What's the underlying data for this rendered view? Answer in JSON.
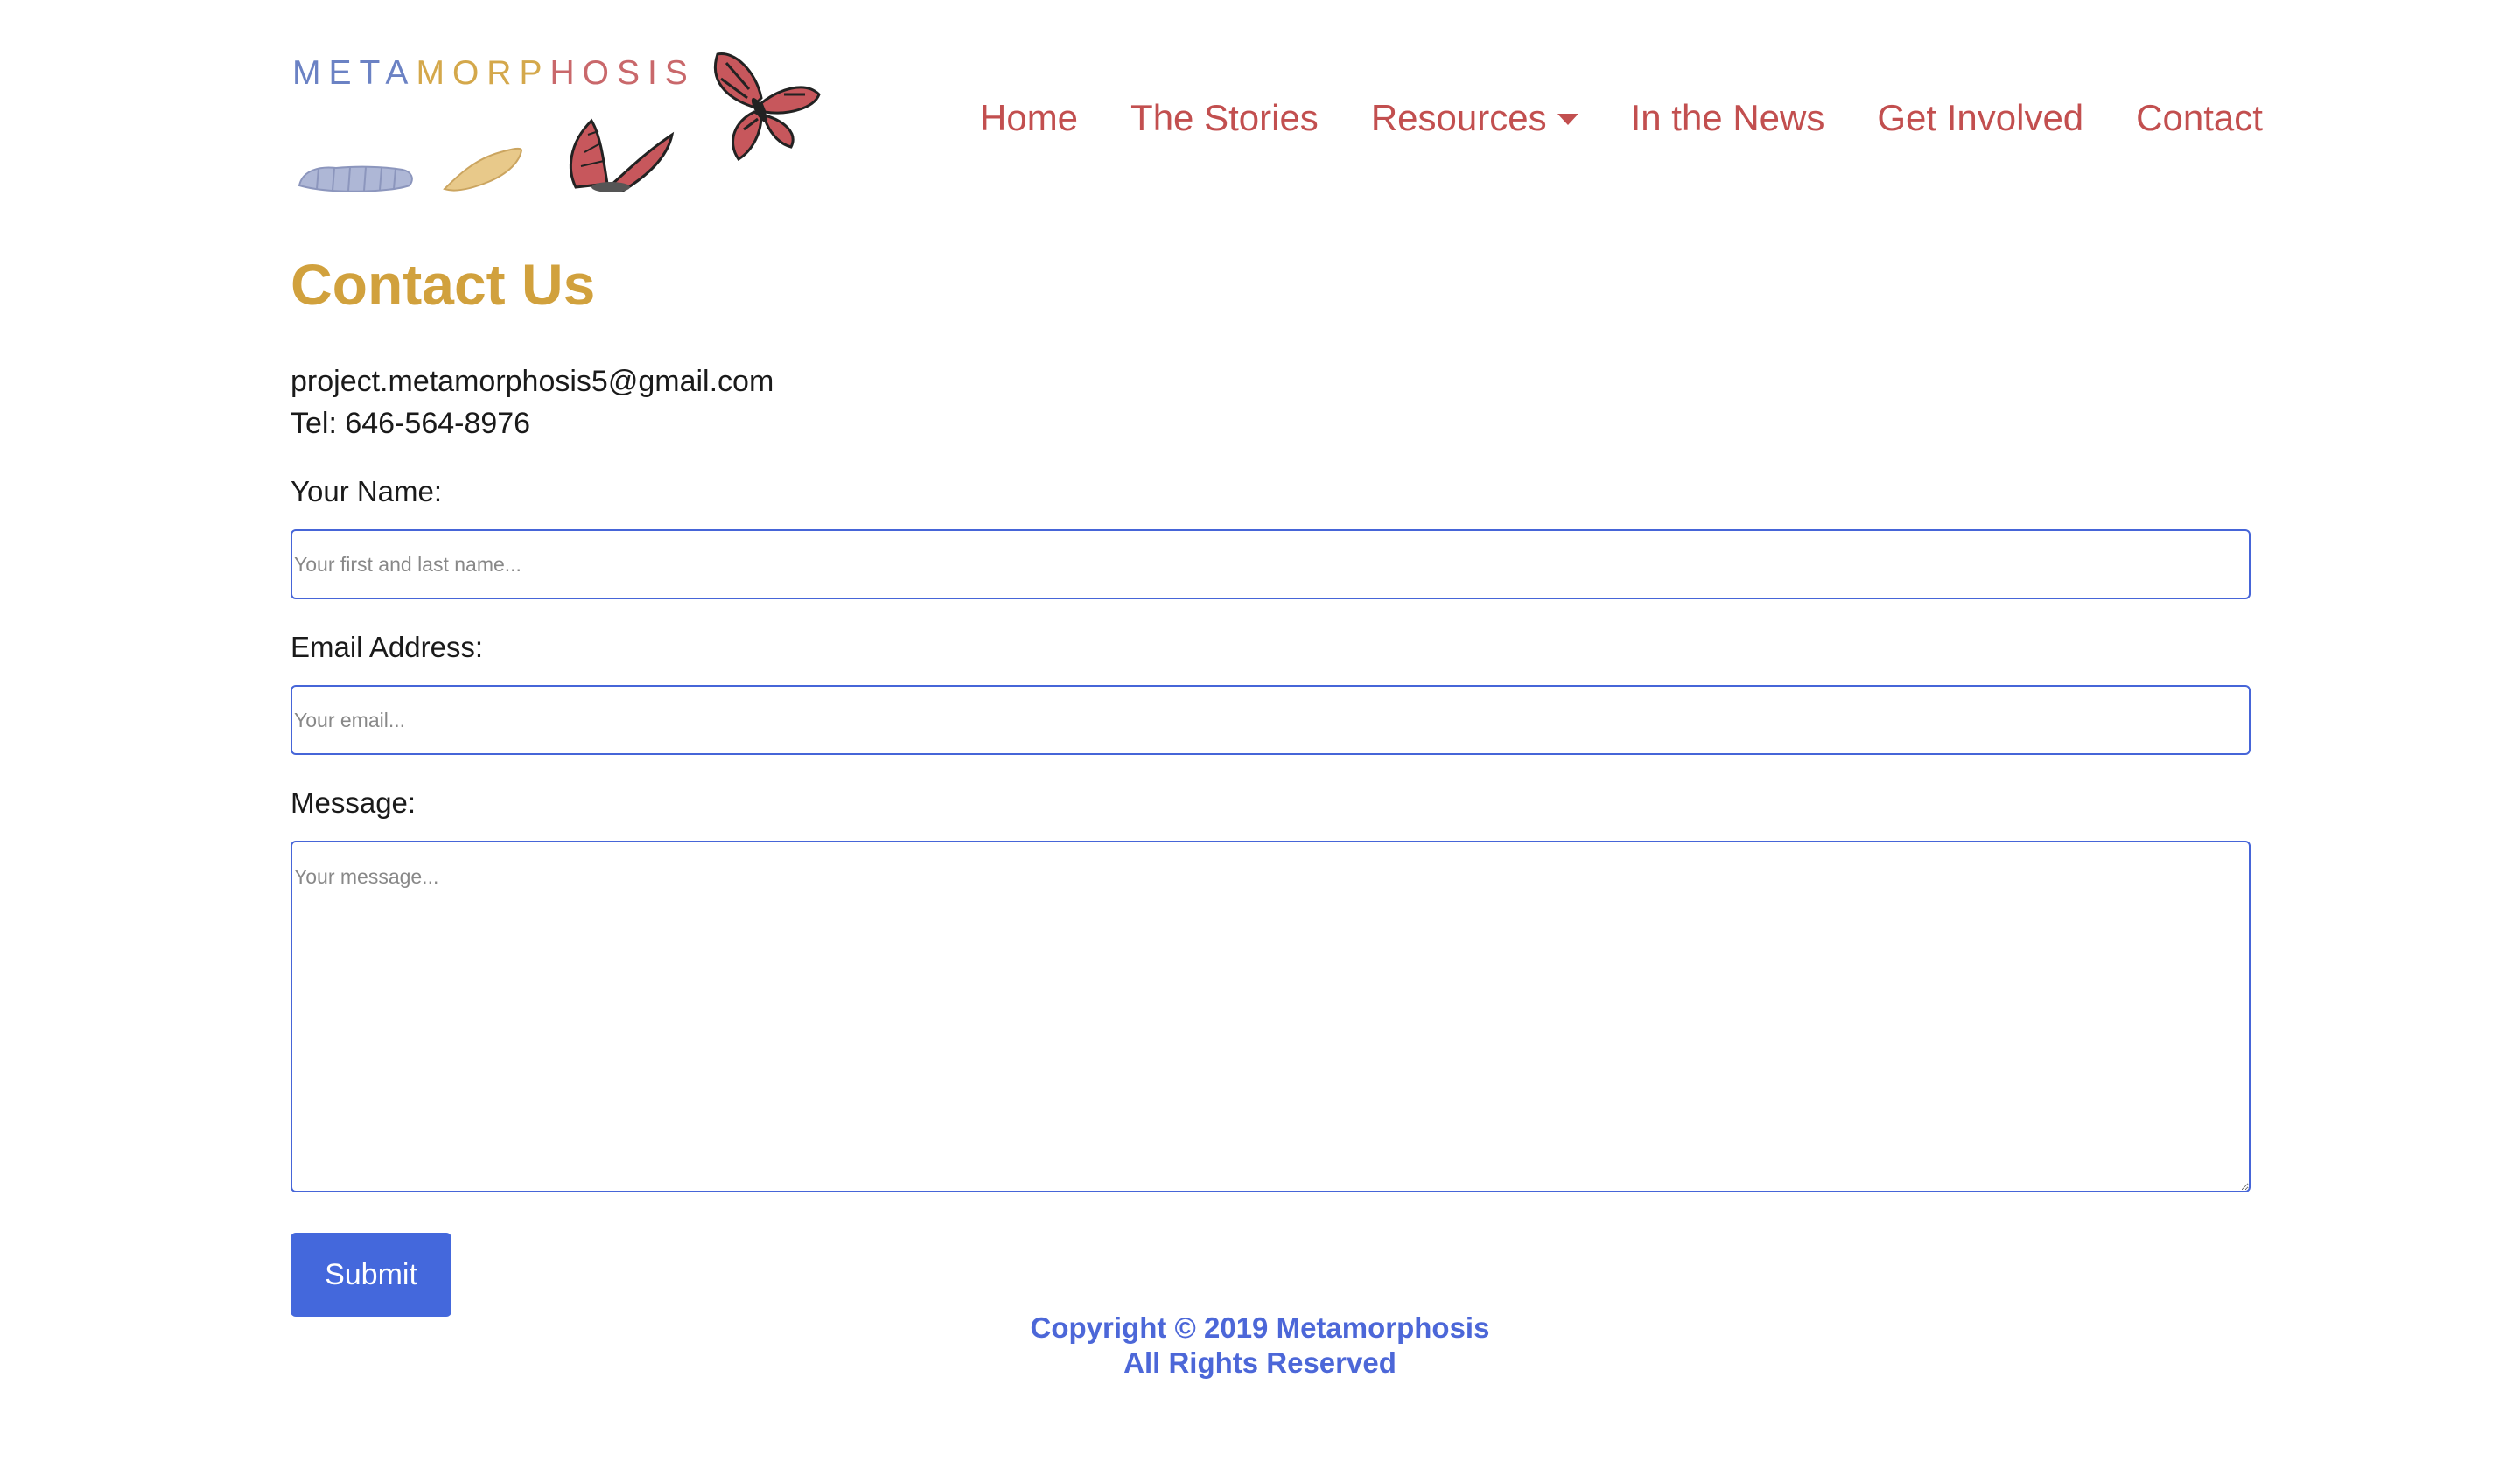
{
  "brand": {
    "logo_parts": [
      "META",
      "MORP",
      "HOSIS"
    ]
  },
  "nav": {
    "items": [
      {
        "label": "Home"
      },
      {
        "label": "The Stories"
      },
      {
        "label": "Resources"
      },
      {
        "label": "In the News"
      },
      {
        "label": "Get Involved"
      },
      {
        "label": "Contact"
      }
    ],
    "dropdown_icon": "caret-down-icon"
  },
  "page": {
    "title": "Contact Us",
    "email": "project.metamorphosis5@gmail.com",
    "phone": "Tel: 646-564-8976"
  },
  "form": {
    "name_label": "Your Name:",
    "name_placeholder": "Your first and last name...",
    "email_label": "Email Address:",
    "email_placeholder": "Your email...",
    "message_label": "Message:",
    "message_placeholder": "Your message...",
    "submit_label": "Submit"
  },
  "footer": {
    "copyright": "Copyright © 2019 Metamorphosis",
    "rights": "All Rights Reserved"
  },
  "colors": {
    "nav": "#c24f4f",
    "title": "#d1a13d",
    "accent": "#4468dc",
    "footer": "#4c67d8"
  }
}
